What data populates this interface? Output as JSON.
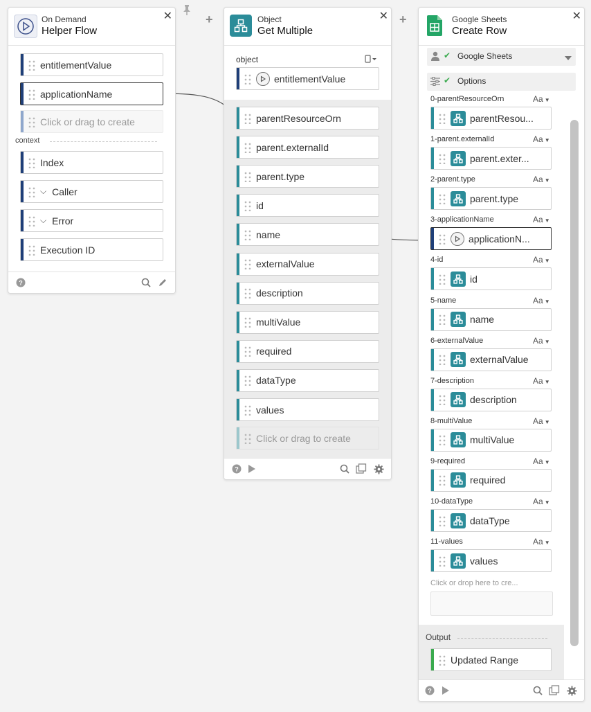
{
  "helper_flow": {
    "subtitle": "On Demand",
    "title": "Helper Flow",
    "inputs": [
      "entitlementValue",
      "applicationName"
    ],
    "create_placeholder": "Click or drag to create",
    "context_label": "context",
    "context_items": [
      "Index",
      "Caller",
      "Error",
      "Execution ID"
    ]
  },
  "get_multiple": {
    "subtitle": "Object",
    "title": "Get Multiple",
    "object_label": "object",
    "object_value": "entitlementValue",
    "outputs": [
      "parentResourceOrn",
      "parent.externalId",
      "parent.type",
      "id",
      "name",
      "externalValue",
      "description",
      "multiValue",
      "required",
      "dataType",
      "values"
    ],
    "create_placeholder": "Click or drag to create"
  },
  "create_row": {
    "subtitle": "Google Sheets",
    "title": "Create Row",
    "connection_label": "Google Sheets",
    "options_label": "Options",
    "aa_label": "Aa",
    "fields": [
      {
        "label": "0-parentResourceOrn",
        "value": "parentResou..."
      },
      {
        "label": "1-parent.externalId",
        "value": "parent.exter..."
      },
      {
        "label": "2-parent.type",
        "value": "parent.type"
      },
      {
        "label": "3-applicationName",
        "value": "applicationN..."
      },
      {
        "label": "4-id",
        "value": "id"
      },
      {
        "label": "5-name",
        "value": "name"
      },
      {
        "label": "6-externalValue",
        "value": "externalValue"
      },
      {
        "label": "7-description",
        "value": "description"
      },
      {
        "label": "8-multiValue",
        "value": "multiValue"
      },
      {
        "label": "9-required",
        "value": "required"
      },
      {
        "label": "10-dataType",
        "value": "dataType"
      },
      {
        "label": "11-values",
        "value": "values"
      }
    ],
    "drop_placeholder": "Click or drop here to cre...",
    "output_label": "Output",
    "output_items": [
      "Updated Range"
    ]
  },
  "colors": {
    "navy": "#1f3f78",
    "teal": "#2b8c99",
    "green": "#3aaa4e",
    "sheets": "#23a566"
  }
}
